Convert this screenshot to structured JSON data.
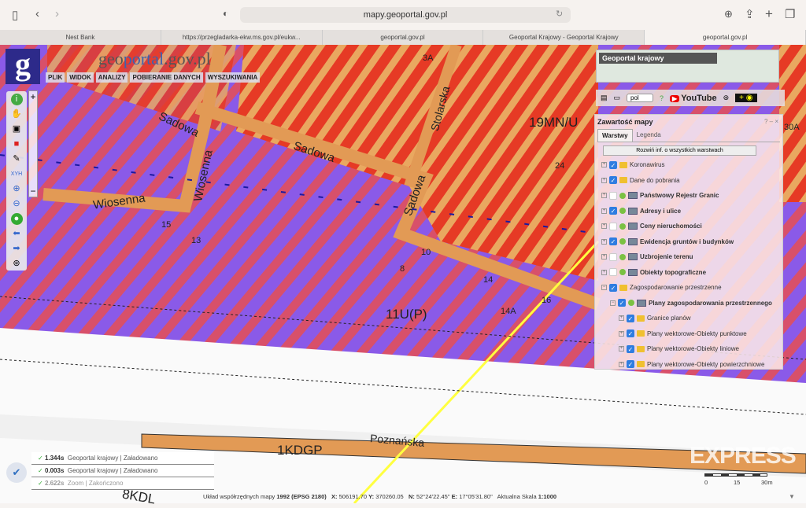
{
  "browser": {
    "url": "mapy.geoportal.gov.pl",
    "tabs": [
      {
        "label": "Nest Bank"
      },
      {
        "label": "https://przegladarka-ekw.ms.gov.pl/eukw..."
      },
      {
        "label": "geoportal.gov.pl"
      },
      {
        "label": "Geoportal Krajowy - Geoportal Krajowy"
      },
      {
        "label": "geoportal.gov.pl"
      }
    ]
  },
  "app": {
    "logo": "g",
    "brand_pre": "geo",
    "brand_mid": "portal",
    "brand_post": ".gov.pl",
    "menu": [
      "PLIK",
      "WIDOK",
      "ANALIZY",
      "POBIERANIE DANYCH",
      "WYSZUKIWANIA"
    ]
  },
  "minimap": {
    "title": "Geoportal krajowy"
  },
  "toolbar": {
    "language": "pol",
    "youtube": "YouTube"
  },
  "panel": {
    "title": "Zawartość mapy",
    "controls": "? – ×",
    "tabs": [
      "Warstwy",
      "Legenda"
    ],
    "expand_button": "Rozwiń inf. o wszystkich warstwach",
    "layers": [
      {
        "label": "Koronawirus",
        "checked": true,
        "type": "folder",
        "bold": false,
        "level": 0
      },
      {
        "label": "Dane do pobrania",
        "checked": true,
        "type": "folder",
        "bold": false,
        "level": 0
      },
      {
        "label": "Państwowy Rejestr Granic",
        "checked": false,
        "type": "service",
        "bold": true,
        "level": 0
      },
      {
        "label": "Adresy i ulice",
        "checked": true,
        "type": "service",
        "bold": true,
        "level": 0
      },
      {
        "label": "Ceny nieruchomości",
        "checked": false,
        "type": "service",
        "bold": true,
        "level": 0
      },
      {
        "label": "Ewidencja gruntów i budynków",
        "checked": true,
        "type": "service",
        "bold": true,
        "level": 0
      },
      {
        "label": "Uzbrojenie terenu",
        "checked": false,
        "type": "service",
        "bold": true,
        "level": 0
      },
      {
        "label": "Obiekty topograficzne",
        "checked": false,
        "type": "service",
        "bold": true,
        "level": 0
      },
      {
        "label": "Zagospodarowanie przestrzenne",
        "checked": true,
        "type": "folder",
        "bold": false,
        "level": 0
      },
      {
        "label": "Plany zagospodarowania przestrzennego",
        "checked": true,
        "type": "service",
        "bold": true,
        "level": 1
      },
      {
        "label": "Granice planów",
        "checked": true,
        "type": "folder",
        "bold": false,
        "level": 2
      },
      {
        "label": "Plany wektorowe-Obiekty punktowe",
        "checked": true,
        "type": "folder",
        "bold": false,
        "level": 2
      },
      {
        "label": "Plany wektorowe-Obiekty liniowe",
        "checked": true,
        "type": "folder",
        "bold": false,
        "level": 2
      },
      {
        "label": "Plany wektorowe-Obiekty powierzchniowe",
        "checked": true,
        "type": "folder",
        "bold": false,
        "level": 2
      }
    ]
  },
  "map_labels": {
    "sadowa1": "Sadowa",
    "sadowa2": "Sadowa",
    "sadowa3": "Sadowa",
    "wiosenna1": "Wiosenna",
    "wiosenna2": "Wiosenna",
    "stolarska": "Stolarska",
    "zone1": "19MN/U",
    "zone2": "11U(P)",
    "road1": "1KDGP",
    "road2": "8KDL",
    "poznanska": "Poznańska",
    "p1": "14",
    "p2": "14A",
    "p3": "16",
    "p4": "13",
    "p5": "15",
    "p6": "10",
    "p7": "8",
    "p8": "24",
    "p9": "3A",
    "p10": "30A"
  },
  "status": [
    {
      "time": "1.344s",
      "source": "Geoportal krajowy",
      "state": "Załadowano"
    },
    {
      "time": "0.003s",
      "source": "Geoportal krajowy",
      "state": "Załadowano"
    },
    {
      "time": "2.622s",
      "source": "Zoom",
      "state": "Zakończono"
    }
  ],
  "coords": {
    "system_label": "Układ współrzędnych mapy",
    "system": "1992 (EPSG 2180)",
    "x_label": "X:",
    "x": "506191.70",
    "y_label": "Y:",
    "y": "370260.05",
    "n_label": "N:",
    "n": "52°24'22.45\"",
    "e_label": "E:",
    "e": "17°05'31.80\"",
    "scale_label": "Aktualna Skala",
    "scale": "1:1000"
  },
  "scalebar": {
    "ticks": [
      "0",
      "15",
      "30m"
    ]
  },
  "watermark": "EXPRESS"
}
